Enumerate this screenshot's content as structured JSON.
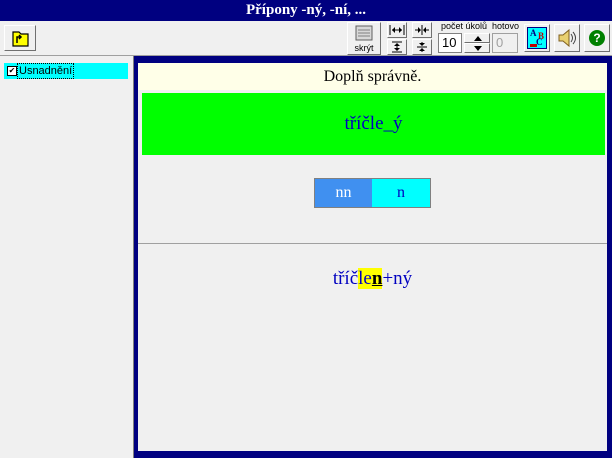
{
  "window": {
    "title": "Přípony -ný, -ní, ..."
  },
  "toolbar": {
    "open_icon": "folder-open-icon",
    "hide_label": "skrýt",
    "count_label": "počet úkolů",
    "count_value": "10",
    "done_label": "hotovo",
    "done_value": "0",
    "spell_letters": [
      "A",
      "B",
      "C"
    ],
    "spell_icon": "abc-spellcheck-icon",
    "speaker_icon": "speaker-icon",
    "help_icon": "help-icon",
    "help_glyph": "?"
  },
  "sidebar": {
    "items": [
      {
        "label": "Usnadnění",
        "checked": true,
        "check_glyph": "✔"
      }
    ]
  },
  "exercise": {
    "instruction": "Doplň správně.",
    "word": "tříčle_ý",
    "choices": [
      "nn",
      "n"
    ],
    "answer": {
      "prefix": "tříč",
      "highlight_pre": "le",
      "highlight_letter": "n",
      "suffix": "+ný"
    }
  },
  "colors": {
    "frame": "#000080",
    "word_box": "#00ff00",
    "choice_selected": "#4090f0",
    "choice_other": "#00ffff",
    "answer_text": "#0000c0",
    "highlight": "#ffff00"
  }
}
